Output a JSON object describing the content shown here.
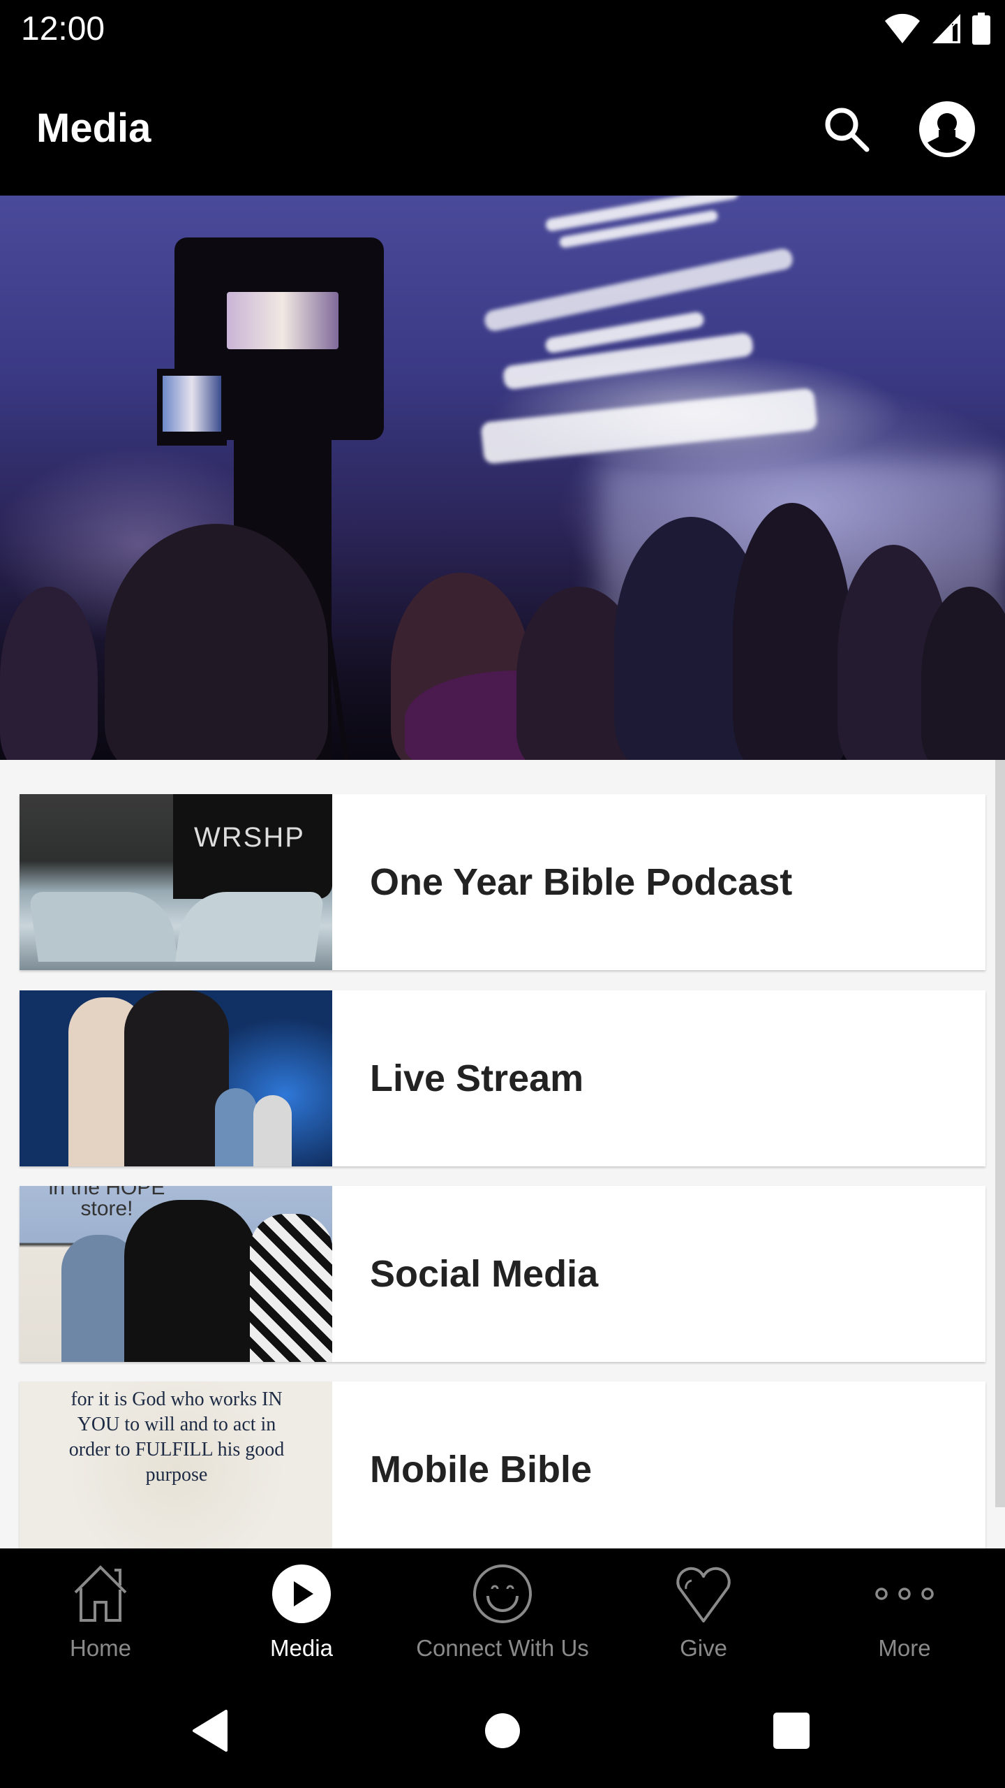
{
  "status_bar": {
    "time": "12:00",
    "icons": [
      "wifi-icon",
      "cell-signal-icon",
      "battery-icon"
    ]
  },
  "app_bar": {
    "title": "Media",
    "actions": [
      {
        "name": "search",
        "icon": "search-icon"
      },
      {
        "name": "profile",
        "icon": "account-circle-icon"
      }
    ]
  },
  "hero": {
    "description": "Worship service photo with video camera in foreground"
  },
  "media_list": {
    "items": [
      {
        "label": "One Year Bible Podcast",
        "thumb": "Open bible with earbuds and WRSHP cap"
      },
      {
        "label": "Live Stream",
        "thumb": "Worship leaders on stage"
      },
      {
        "label": "Social Media",
        "thumb": "Three people smiling in front of HOPE store sign",
        "thumb_text": "in the HOPE store!"
      },
      {
        "label": "Mobile Bible",
        "thumb": "Scripture graphic",
        "thumb_text": "for it is God who works IN YOU to will and to act in order to FULFILL his good purpose"
      }
    ]
  },
  "bottom_nav": {
    "active": "Media",
    "items": [
      {
        "label": "Home",
        "icon": "home-icon"
      },
      {
        "label": "Media",
        "icon": "play-circle-icon"
      },
      {
        "label": "Connect With Us",
        "icon": "smiley-icon"
      },
      {
        "label": "Give",
        "icon": "heart-icon"
      },
      {
        "label": "More",
        "icon": "more-dots-icon"
      }
    ]
  },
  "system_nav": {
    "buttons": [
      "back",
      "home",
      "recents"
    ]
  },
  "colors": {
    "bar_background": "#000000",
    "content_background": "#f5f5f5",
    "card_background": "#ffffff",
    "card_text": "#222222",
    "nav_inactive": "#8a8a8a",
    "nav_active": "#ffffff",
    "scrollbar": "#d3d3d3"
  }
}
